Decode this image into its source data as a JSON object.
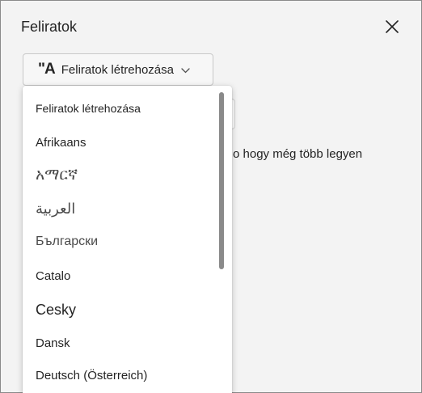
{
  "panel": {
    "title": "Feliratok",
    "close_icon": "close-icon"
  },
  "captions_button": {
    "icon_glyph": "\"A",
    "label": "Feliratok létrehozása",
    "chevron_icon": "chevron-down-icon"
  },
  "background": {
    "partial_text": "o hogy még több legyen"
  },
  "dropdown": {
    "items": [
      {
        "label": "Feliratok létrehozása"
      },
      {
        "label": "Afrikaans"
      },
      {
        "label": "አማርኛ"
      },
      {
        "label": "العربية"
      },
      {
        "label": "Български"
      },
      {
        "label": "Catalo"
      },
      {
        "label": "Cesky"
      },
      {
        "label": "Dansk"
      },
      {
        "label": "Deutsch (Österreich)"
      }
    ]
  },
  "colors": {
    "panel_bg": "#f3f3f3",
    "text": "#242424",
    "scrollbar": "#8a8a8a"
  }
}
